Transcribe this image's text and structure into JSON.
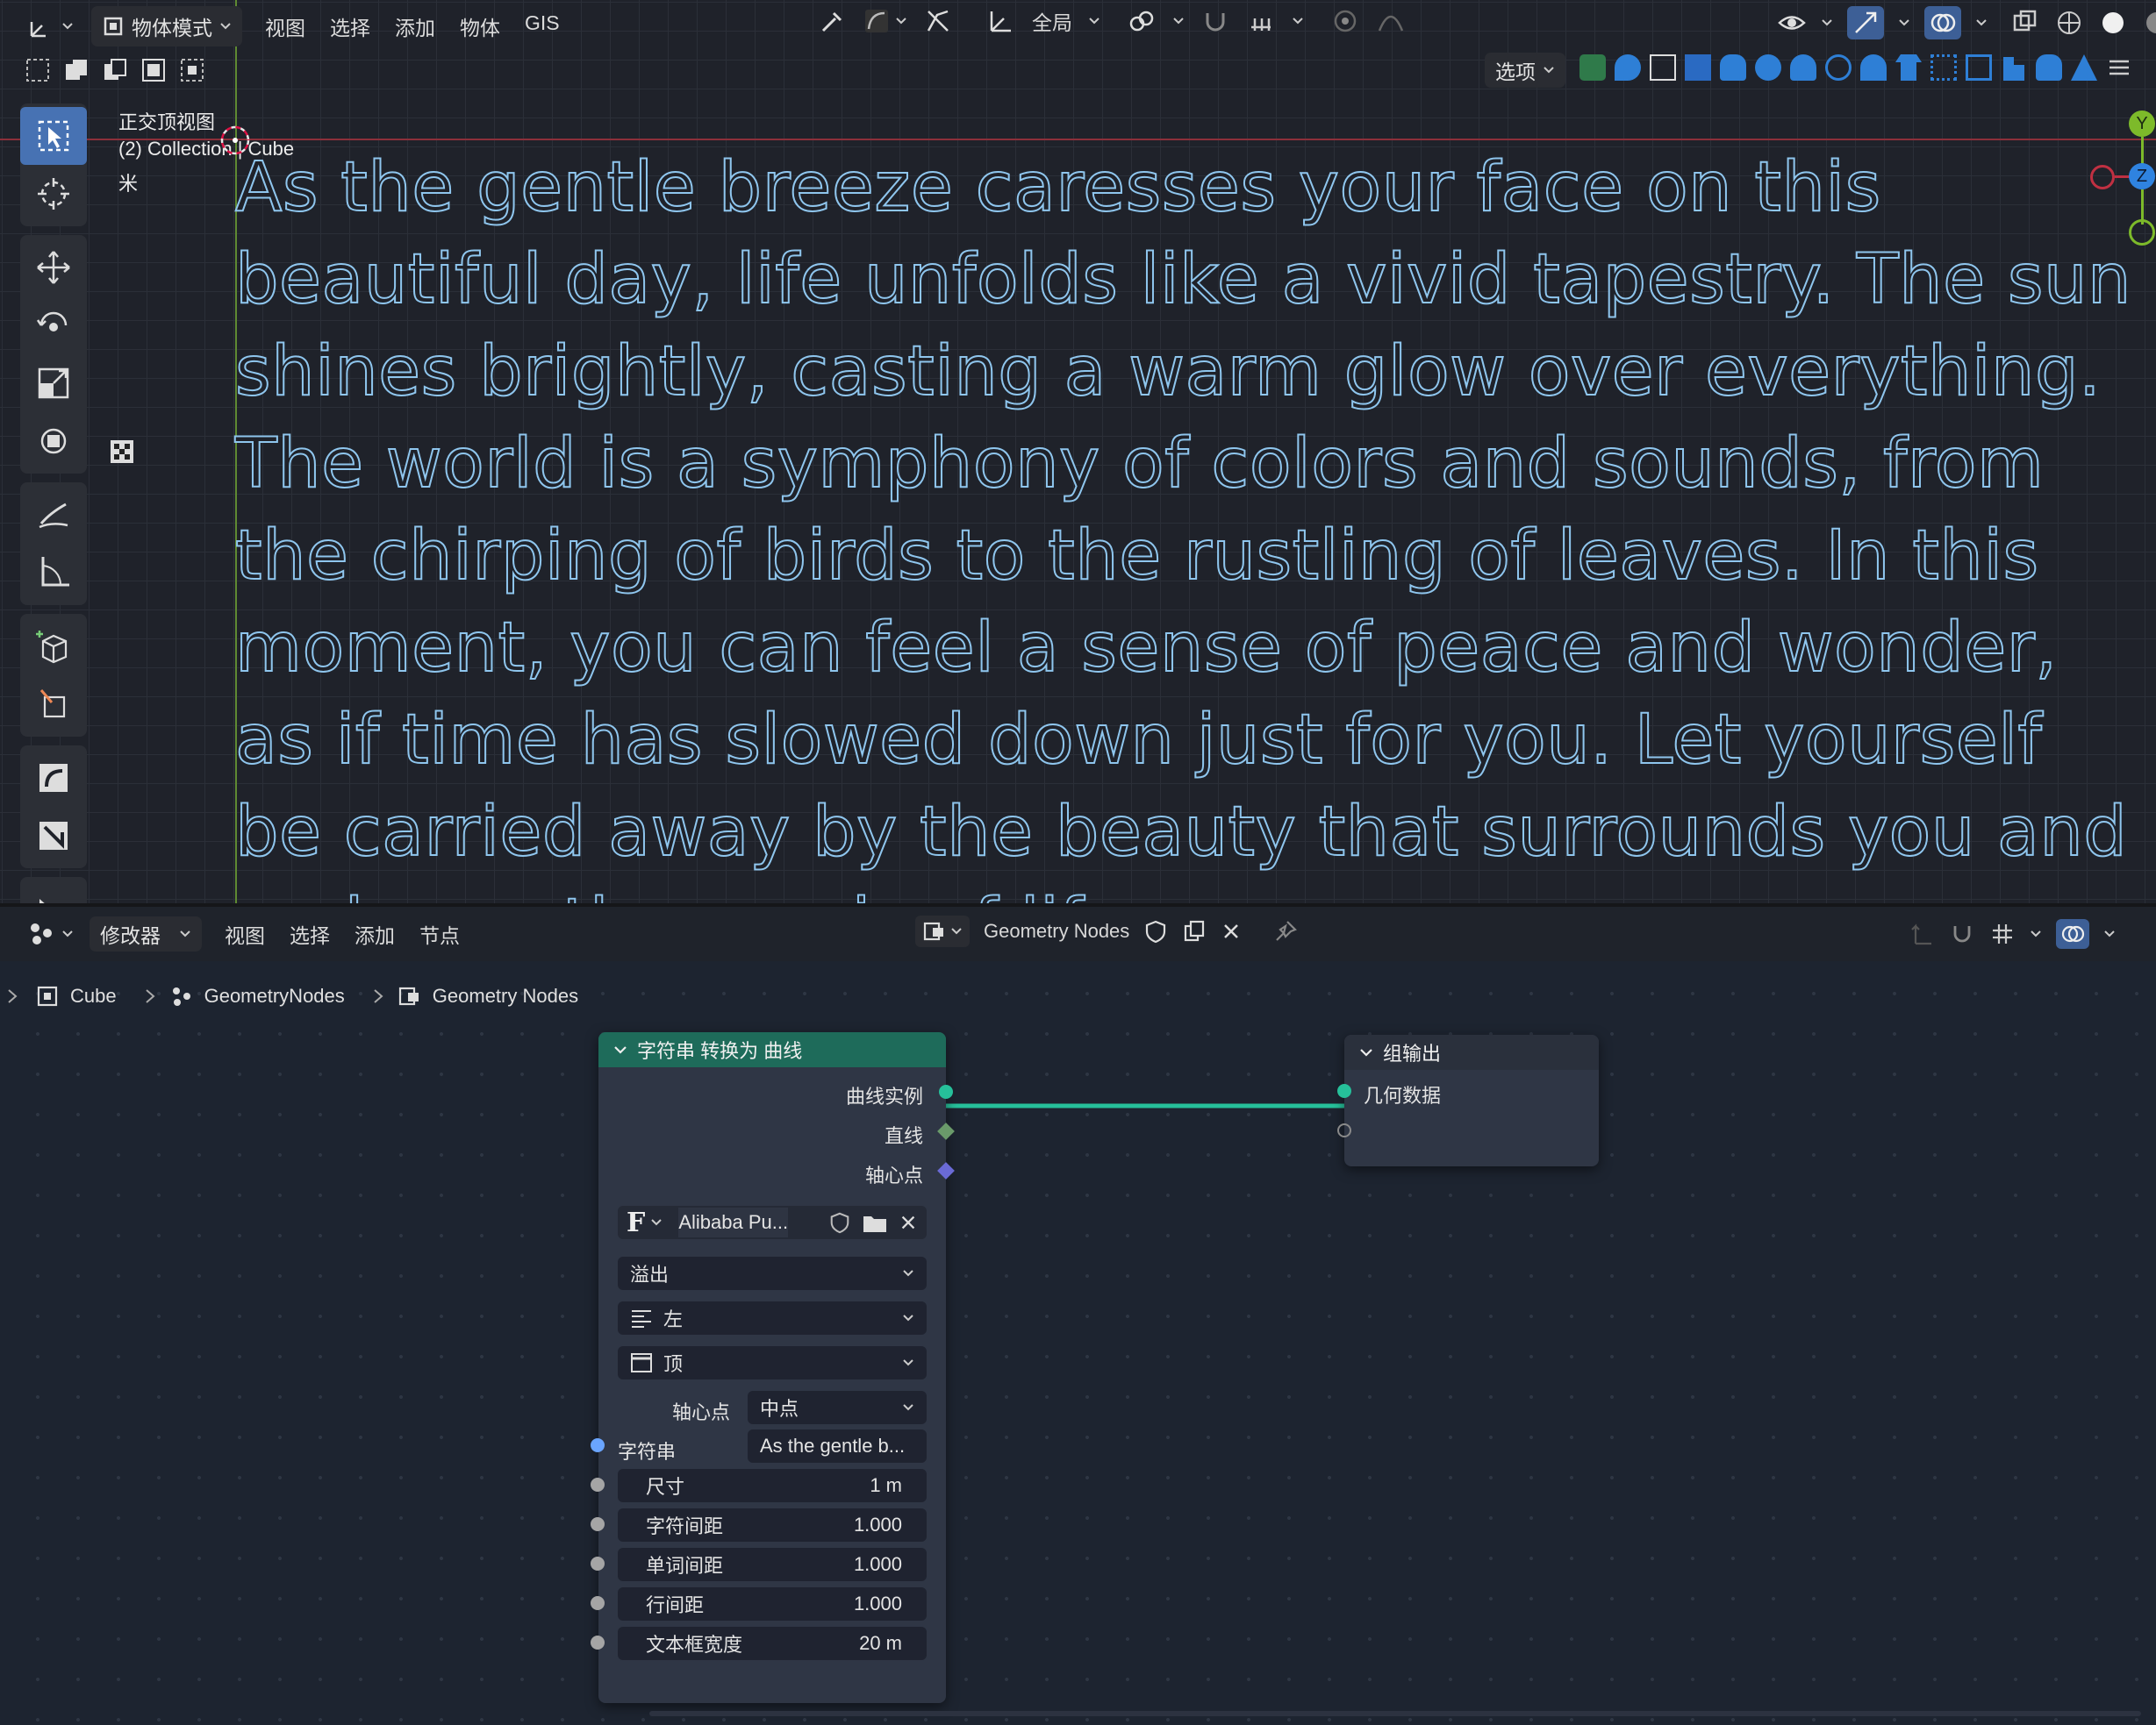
{
  "viewport": {
    "header": {
      "mode_label": "物体模式",
      "menus": [
        "视图",
        "选择",
        "添加",
        "物体",
        "GIS"
      ],
      "transform_orientation": "全局",
      "options_label": "选项"
    },
    "info": {
      "view_name": "正交顶视图",
      "collection_line": "(2) Collection | Cube",
      "units": "米"
    },
    "scene_text": "As the gentle breeze caresses your face on this beautiful day, life unfolds like a vivid tapestry. The sun shines brightly, casting a warm glow over everything. The world is a symphony of colors and sounds, from the chirping of birds to the rustling of leaves. In this moment, you can feel a sense of peace and wonder, as if time has slowed down just for you. Let yourself be carried away by the beauty that surrounds you and embrace the magic of life.",
    "gizmo": {
      "y": "Y",
      "z": "Z"
    },
    "tools": [
      "select-box",
      "cursor",
      "move",
      "rotate",
      "scale",
      "transform",
      "annotate",
      "measure",
      "add-cube",
      "extrude",
      "shear",
      "shrink",
      "knife"
    ]
  },
  "node_editor": {
    "header": {
      "editor_type": "修改器",
      "menus": [
        "视图",
        "选择",
        "添加",
        "节点"
      ],
      "tree_name": "Geometry Nodes"
    },
    "breadcrumb": [
      "Cube",
      "GeometryNodes",
      "Geometry Nodes"
    ],
    "string_to_curves": {
      "title": "字符串 转换为 曲线",
      "outputs": [
        "曲线实例",
        "直线",
        "轴心点"
      ],
      "font_name": "Alibaba Pu...",
      "overflow": "溢出",
      "align_x": "左",
      "align_y": "顶",
      "pivot_label": "轴心点",
      "pivot_value": "中点",
      "string_label": "字符串",
      "string_value": "As the gentle b...",
      "size_label": "尺寸",
      "size_value": "1 m",
      "char_spacing_label": "字符间距",
      "char_spacing_value": "1.000",
      "word_spacing_label": "单词间距",
      "word_spacing_value": "1.000",
      "line_spacing_label": "行间距",
      "line_spacing_value": "1.000",
      "text_box_width_label": "文本框宽度",
      "text_box_width_value": "20 m"
    },
    "group_output": {
      "title": "组输出",
      "input_label": "几何数据"
    }
  },
  "colors": {
    "header_green": "#1e6b5a",
    "active_tool": "#4772b3",
    "link_green": "#26c09a",
    "text_outline": "#8fc6ee"
  }
}
